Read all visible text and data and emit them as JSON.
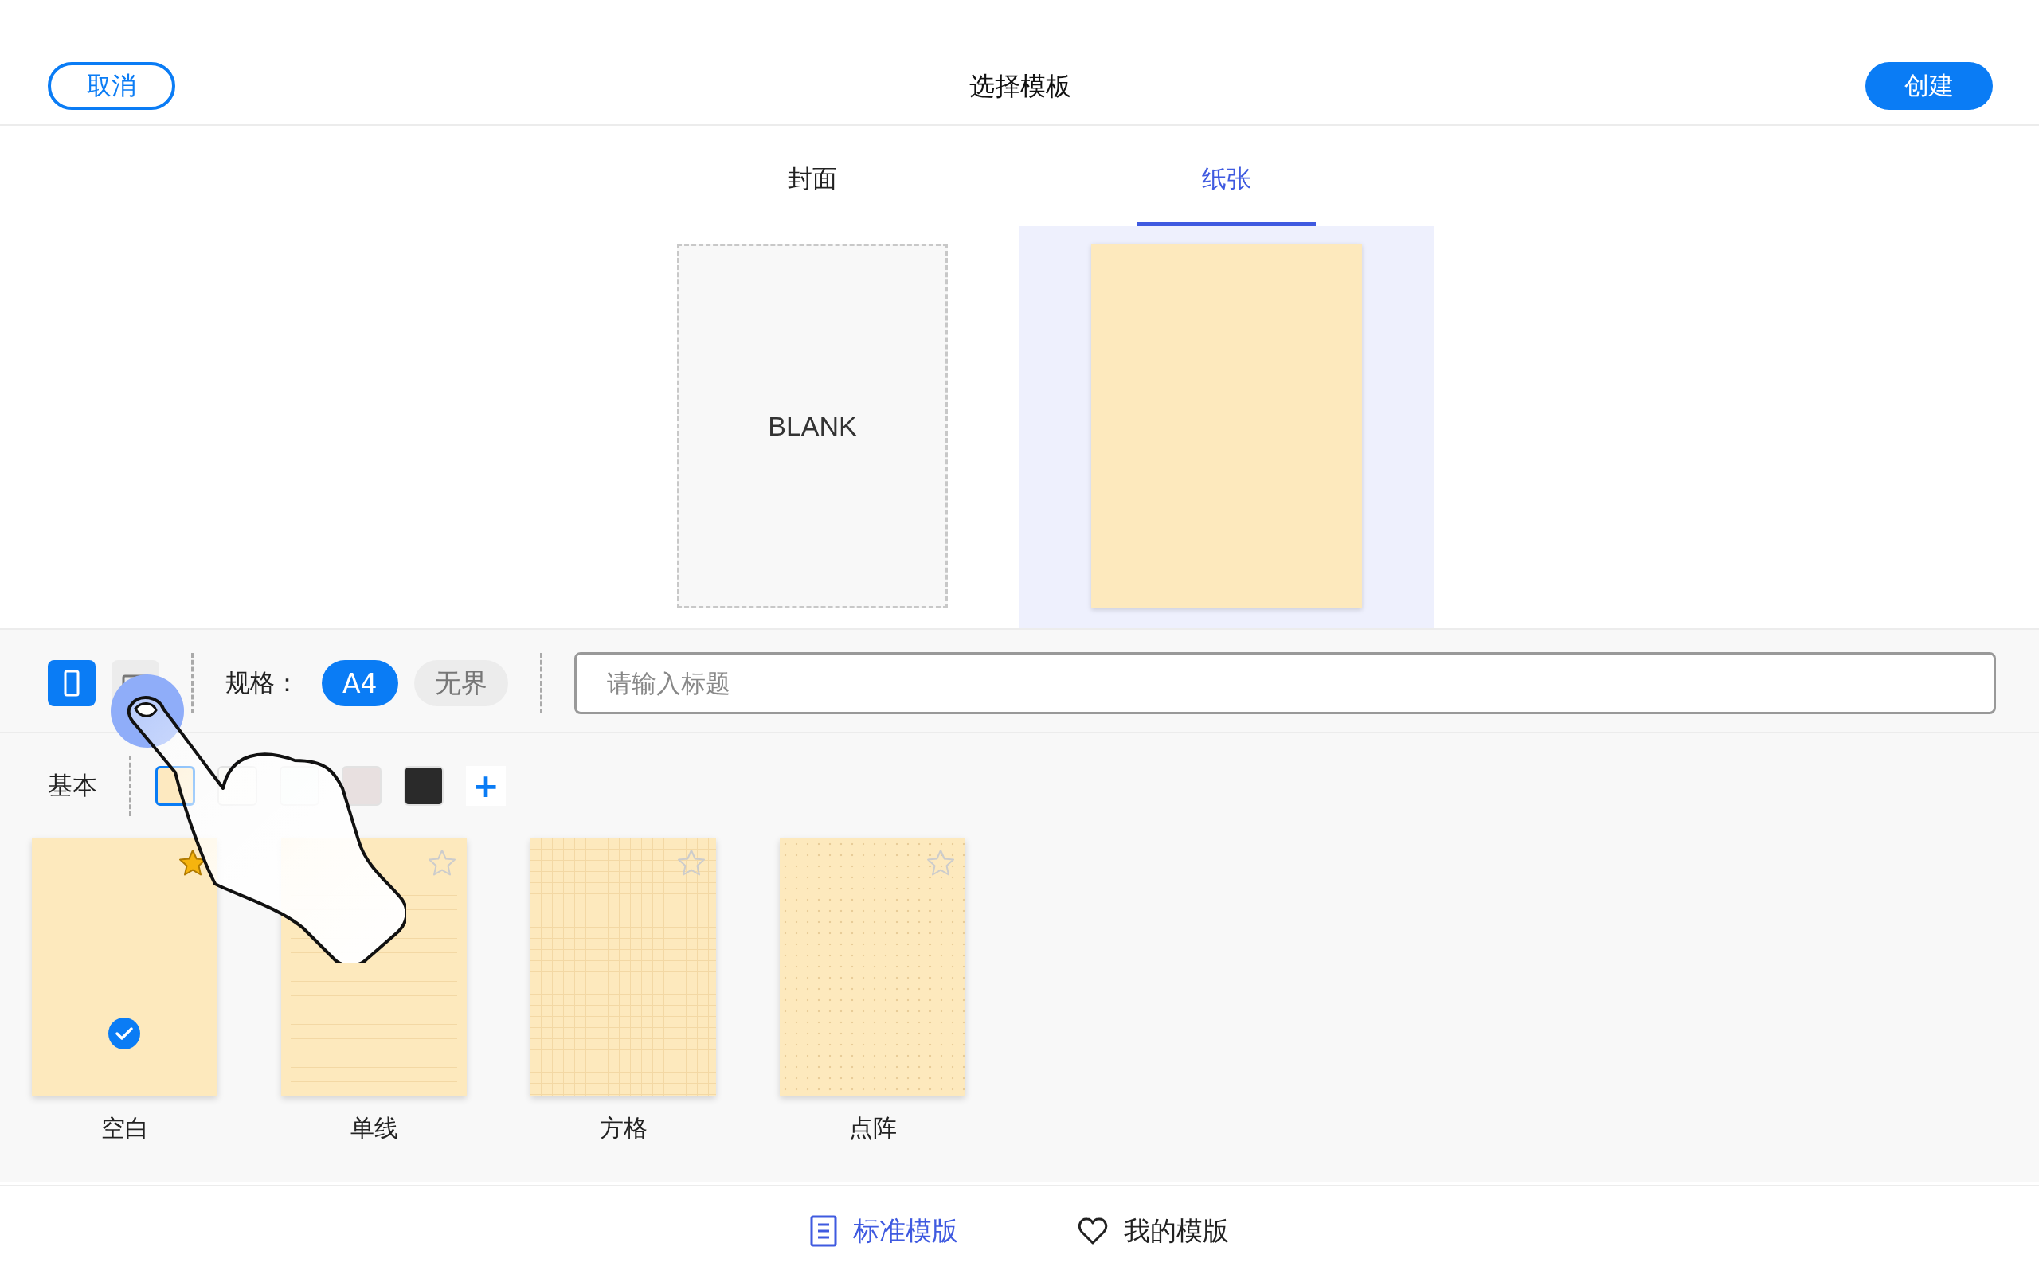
{
  "header": {
    "cancel": "取消",
    "title": "选择模板",
    "create": "创建"
  },
  "tabs": [
    {
      "label": "封面",
      "selected": false
    },
    {
      "label": "纸张",
      "selected": true
    }
  ],
  "previews": [
    {
      "kind": "blank",
      "label": "BLANK",
      "selected": false
    },
    {
      "kind": "paper",
      "selected": true
    }
  ],
  "toolbar": {
    "orientations": [
      {
        "kind": "portrait",
        "selected": true
      },
      {
        "kind": "landscape",
        "selected": false
      }
    ],
    "size_label": "规格：",
    "sizes": [
      {
        "label": "A4",
        "selected": true
      },
      {
        "label": "无界",
        "selected": false
      }
    ],
    "title_field": {
      "placeholder": "请输入标题"
    }
  },
  "colors": {
    "label": "基本",
    "swatches": [
      {
        "color": "#fde9c0",
        "selected": true
      },
      {
        "color": "#fbfbf8",
        "selected": false
      },
      {
        "color": "#f3faf8",
        "selected": false
      },
      {
        "color": "#e8e0e0",
        "selected": false
      },
      {
        "color": "#2a2a2a",
        "selected": false
      }
    ],
    "add": "+"
  },
  "templates": [
    {
      "label": "空白",
      "kind": "blank",
      "favorite": true,
      "selected": true
    },
    {
      "label": "单线",
      "kind": "lined",
      "favorite": false,
      "selected": false
    },
    {
      "label": "方格",
      "kind": "grid",
      "favorite": false,
      "selected": false
    },
    {
      "label": "点阵",
      "kind": "dotted",
      "favorite": false,
      "selected": false
    }
  ],
  "bottom_tabs": [
    {
      "label": "标准模版",
      "kind": "document",
      "selected": true
    },
    {
      "label": "我的模版",
      "kind": "heart",
      "selected": false
    }
  ]
}
